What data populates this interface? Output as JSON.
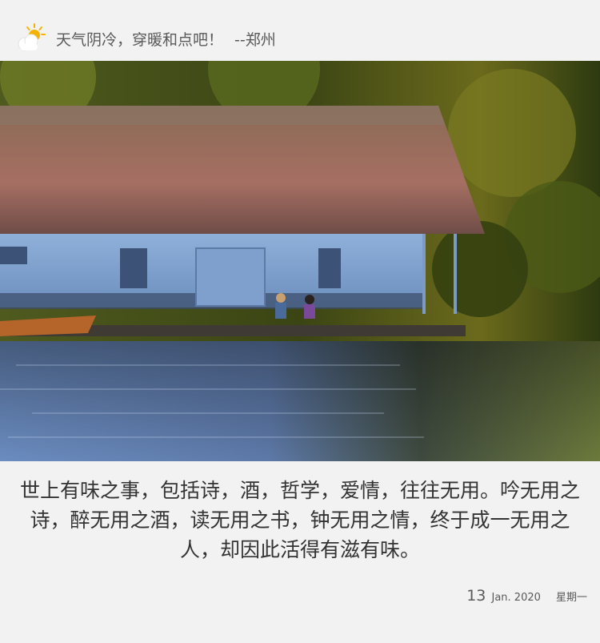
{
  "header": {
    "weather_icon": "partly-cloudy-icon",
    "weather_message": "天气阴冷，穿暖和点吧！",
    "city": "--郑州"
  },
  "photo": {
    "subject": "lakeside-thatched-cottage"
  },
  "quote": {
    "text": "世上有味之事，包括诗，酒，哲学，爱情，往往无用。吟无用之诗，醉无用之酒，读无用之书，钟无用之情，终于成一无用之人，却因此活得有滋有味。"
  },
  "date": {
    "day": "13",
    "month_year": "Jan. 2020",
    "weekday": "星期一"
  },
  "colors": {
    "background": "#f2f2f2",
    "text": "#333333",
    "muted": "#595959",
    "sun": "#f5b301"
  }
}
